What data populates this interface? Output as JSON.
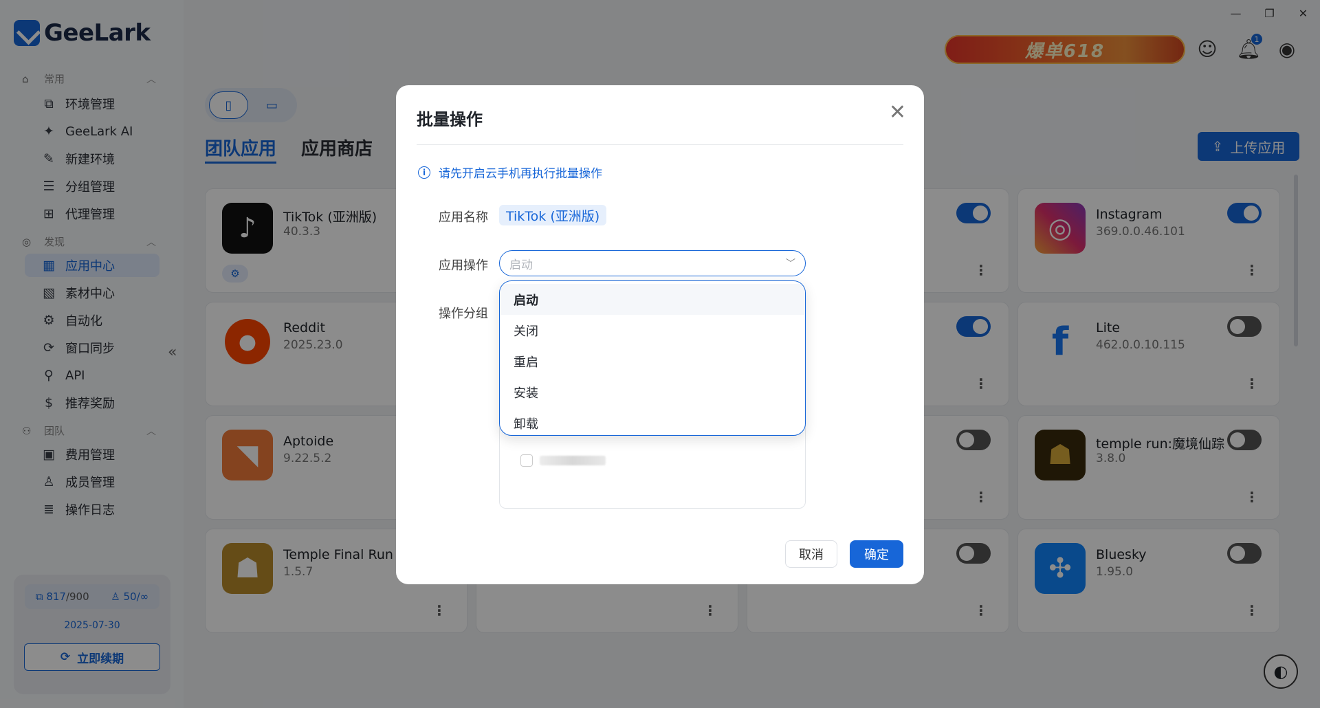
{
  "app": {
    "logo_text": "GeeLark"
  },
  "sidebar": {
    "sections": [
      {
        "label": "常用",
        "icon": "home-icon",
        "items": [
          {
            "label": "环境管理",
            "icon": "environment-icon"
          },
          {
            "label": "GeeLark AI",
            "icon": "ai-icon"
          },
          {
            "label": "新建环境",
            "icon": "edit-icon"
          },
          {
            "label": "分组管理",
            "icon": "list-icon"
          },
          {
            "label": "代理管理",
            "icon": "proxy-icon"
          }
        ]
      },
      {
        "label": "发现",
        "icon": "discover-icon",
        "items": [
          {
            "label": "应用中心",
            "icon": "apps-icon",
            "active": true
          },
          {
            "label": "素材中心",
            "icon": "image-icon"
          },
          {
            "label": "自动化",
            "icon": "robot-icon"
          },
          {
            "label": "窗口同步",
            "icon": "sync-icon"
          },
          {
            "label": "API",
            "icon": "api-icon"
          },
          {
            "label": "推荐奖励",
            "icon": "dollar-icon"
          }
        ]
      },
      {
        "label": "团队",
        "icon": "team-icon",
        "items": [
          {
            "label": "费用管理",
            "icon": "billing-icon"
          },
          {
            "label": "成员管理",
            "icon": "member-icon"
          },
          {
            "label": "操作日志",
            "icon": "log-icon"
          }
        ]
      }
    ],
    "plan": {
      "devices": "817",
      "devices_total": "/900",
      "members": "50/∞",
      "expiry": "2025-07-30",
      "renew_label": "立即续期"
    }
  },
  "topbar": {
    "promo_text": "爆单618",
    "notification_count": "1"
  },
  "main": {
    "tabs": [
      {
        "label": "团队应用",
        "active": true
      },
      {
        "label": "应用商店",
        "active": false
      }
    ],
    "upload_label": "上传应用",
    "apps": [
      {
        "name": "TikTok (亚洲版)",
        "version": "40.3.3",
        "icon": "tiktok-icon",
        "toggle": null,
        "tag": true
      },
      {
        "name": "Instagram",
        "version": "369.0.0.46.101",
        "icon": "instagram-icon",
        "toggle": true
      },
      {
        "name": "Reddit",
        "version": "2025.23.0",
        "icon": "reddit-icon",
        "toggle": null
      },
      {
        "name": "Lite",
        "version": "462.0.0.10.115",
        "icon": "facebook-icon",
        "toggle": false
      },
      {
        "name": "Aptoide",
        "version": "9.22.5.2",
        "icon": "aptoide-icon",
        "toggle": null
      },
      {
        "name": "temple run:魔境仙踪",
        "version": "3.8.0",
        "icon": "temple-run-icon",
        "toggle": false
      },
      {
        "name": "Temple Final Run 3",
        "version": "1.5.7",
        "icon": "temple-final-run-icon",
        "toggle": null
      },
      {
        "name": "Bluesky",
        "version": "1.95.0",
        "icon": "bluesky-icon",
        "toggle": false
      }
    ],
    "hidden_card_toggles": [
      true,
      true,
      false,
      false
    ]
  },
  "modal": {
    "title": "批量操作",
    "notice": "请先开启云手机再执行批量操作",
    "app_name_label": "应用名称",
    "app_name_value": "TikTok (亚洲版)",
    "operation_label": "应用操作",
    "operation_placeholder": "启动",
    "group_label": "操作分组",
    "operation_options": [
      "启动",
      "关闭",
      "重启",
      "安装",
      "卸载"
    ],
    "selected_option": "启动",
    "cancel_label": "取消",
    "ok_label": "确定"
  },
  "colors": {
    "accent": "#1766d8",
    "overlay": "rgba(0,0,0,0.45)"
  }
}
